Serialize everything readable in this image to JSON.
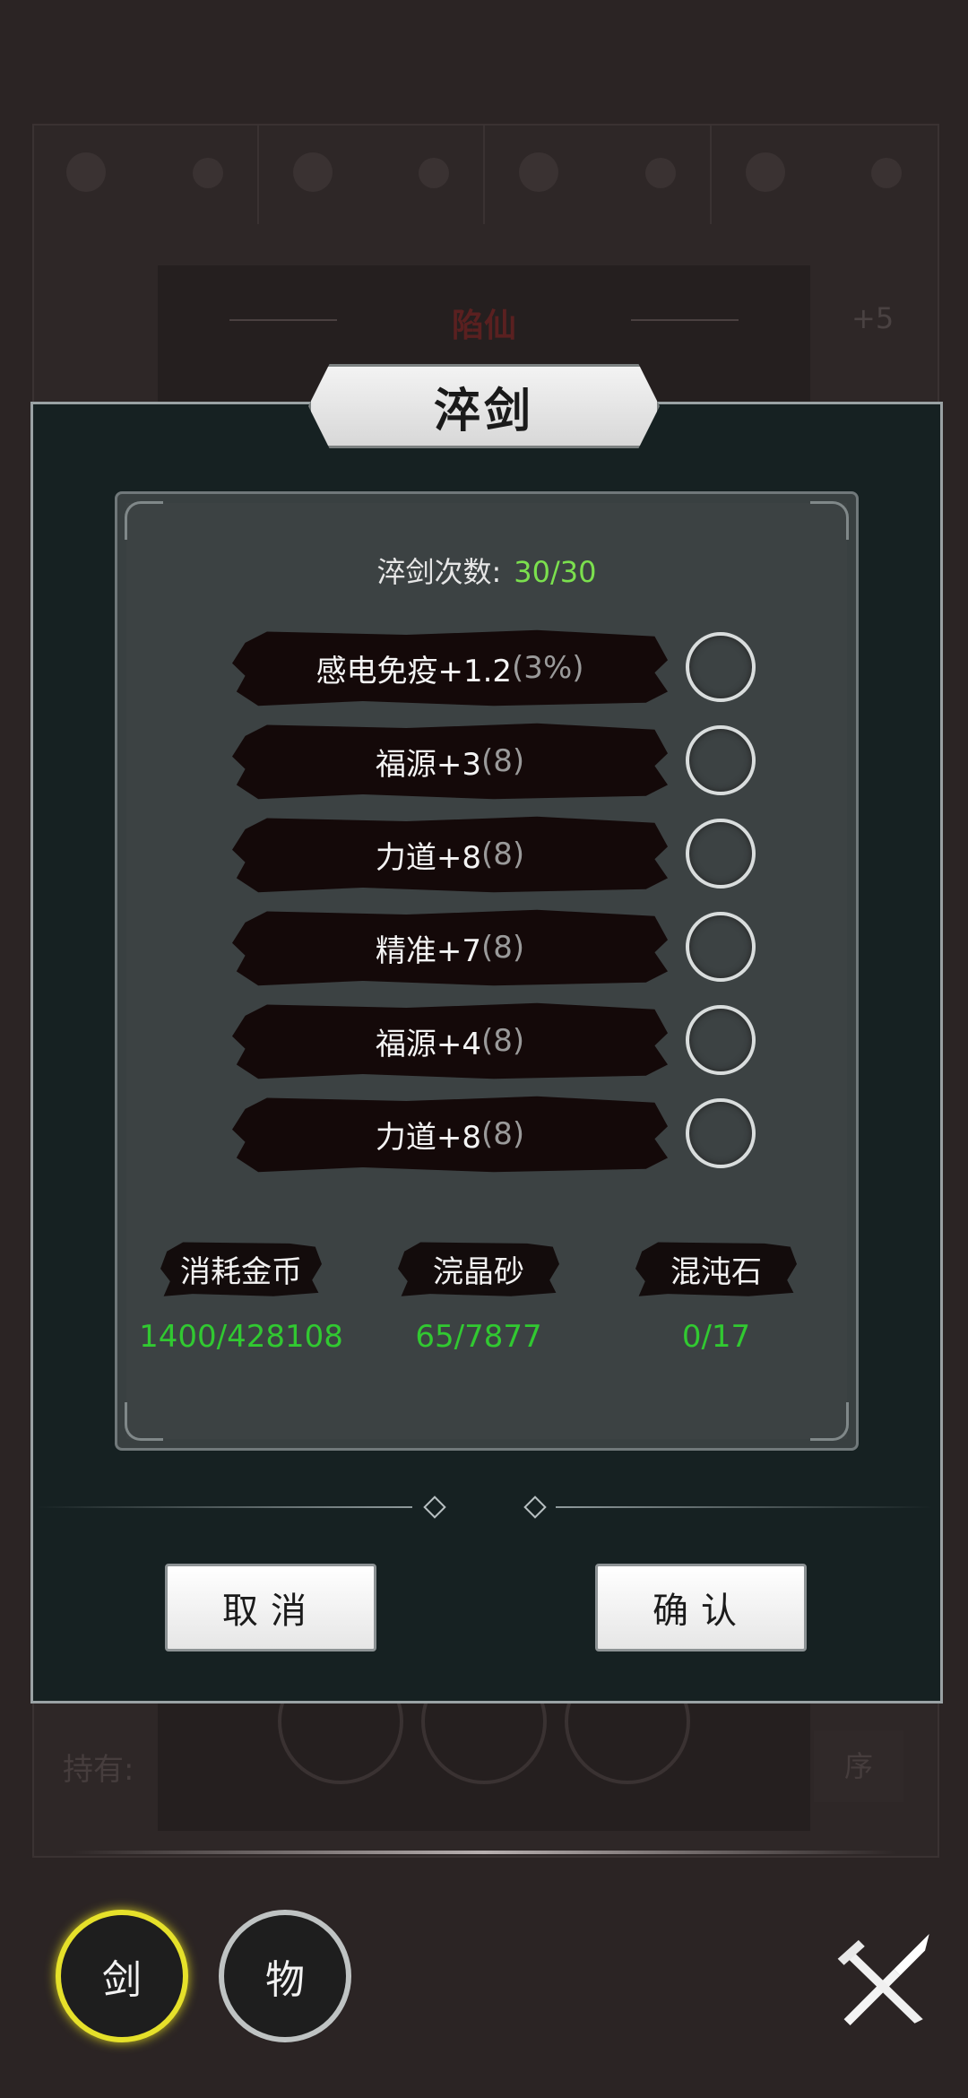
{
  "background": {
    "card_title": "陷仙",
    "level_tag": "+5",
    "hold_label": "持有:",
    "sort_label": "序"
  },
  "modal": {
    "title": "淬剑",
    "count_label": "淬剑次数:",
    "count_value": "30/30",
    "stats": [
      {
        "text": "感电免疫+1.2",
        "extra": "(3%)"
      },
      {
        "text": "福源+3",
        "extra": "(8)"
      },
      {
        "text": "力道+8",
        "extra": "(8)"
      },
      {
        "text": "精准+7",
        "extra": "(8)"
      },
      {
        "text": "福源+4",
        "extra": "(8)"
      },
      {
        "text": "力道+8",
        "extra": "(8)"
      }
    ],
    "resources": [
      {
        "label": "消耗金币",
        "value": "1400/428108"
      },
      {
        "label": "浣晶砂",
        "value": "65/7877"
      },
      {
        "label": "混沌石",
        "value": "0/17"
      }
    ],
    "cancel_label": "取消",
    "confirm_label": "确认"
  },
  "nav": {
    "sword_tab": "剑",
    "item_tab": "物",
    "battle_icon": "crossed-swords-icon"
  },
  "colors": {
    "count_value": "#7be04e",
    "resource_value": "#31c931",
    "active_tab_ring": "#e6e12a"
  }
}
